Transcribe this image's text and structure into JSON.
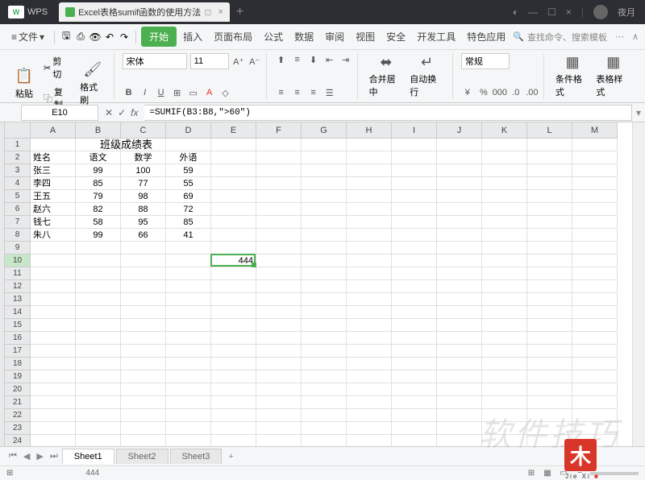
{
  "titlebar": {
    "app": "WPS",
    "doc_title": "Excel表格sumif函数的使用方法",
    "user": "夜月",
    "close": "×",
    "plus": "+"
  },
  "menu": {
    "file": "文件",
    "tabs": [
      "开始",
      "插入",
      "页面布局",
      "公式",
      "数据",
      "审阅",
      "视图",
      "安全",
      "开发工具",
      "特色应用"
    ],
    "search_placeholder": "查找命令、搜索模板"
  },
  "ribbon": {
    "paste": "粘贴",
    "cut": "剪切",
    "copy": "复制",
    "format_painter": "格式刷",
    "font_name": "宋体",
    "font_size": "11",
    "merge_center": "合并居中",
    "wrap_text": "自动换行",
    "number_format": "常规",
    "cond_format": "条件格式",
    "table_style": "表格样式",
    "b": "B",
    "i": "I",
    "u": "U"
  },
  "formula": {
    "cell_ref": "E10",
    "fx": "fx",
    "value": "=SUMIF(B3:B8,\">60\")"
  },
  "columns": [
    "A",
    "B",
    "C",
    "D",
    "E",
    "F",
    "G",
    "H",
    "I",
    "J",
    "K",
    "L",
    "M"
  ],
  "rows_count": 24,
  "active_row": 10,
  "active_col": 5,
  "table": {
    "title": "班级成绩表",
    "headers": [
      "姓名",
      "语文",
      "数学",
      "外语"
    ],
    "rows": [
      [
        "张三",
        "99",
        "100",
        "59"
      ],
      [
        "李四",
        "85",
        "77",
        "55"
      ],
      [
        "王五",
        "79",
        "98",
        "69"
      ],
      [
        "赵六",
        "82",
        "88",
        "72"
      ],
      [
        "钱七",
        "58",
        "95",
        "85"
      ],
      [
        "朱八",
        "99",
        "66",
        "41"
      ]
    ],
    "result": "444"
  },
  "sheets": {
    "tabs": [
      "Sheet1",
      "Sheet2",
      "Sheet3"
    ],
    "add": "+"
  },
  "status": {
    "sum_label": "444"
  },
  "watermark": "软件技巧",
  "stamp": {
    "char": "木",
    "label": "Jie Xi"
  }
}
